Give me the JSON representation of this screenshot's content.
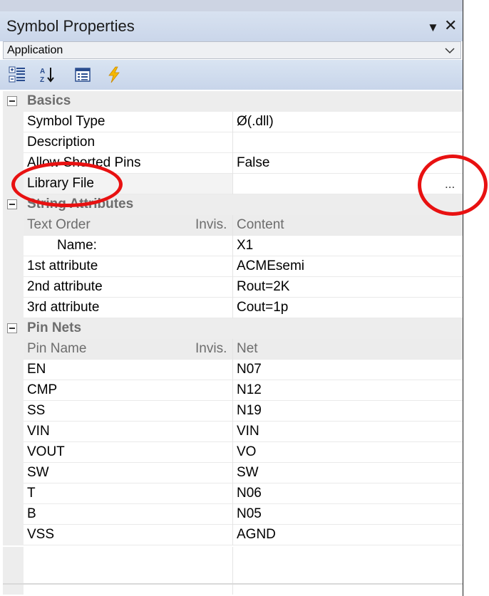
{
  "window": {
    "title": "Symbol Properties",
    "pin_glyph": "▼",
    "close_glyph": "✕"
  },
  "selector": {
    "value": "Application"
  },
  "toolbar": {
    "icons": [
      "categorized-icon",
      "alphabetical-sort-icon",
      "property-pages-icon",
      "events-icon"
    ]
  },
  "grid": {
    "basics": {
      "label": "Basics",
      "rows": [
        {
          "name": "Symbol Type",
          "value": "Ø(.dll)"
        },
        {
          "name": "Description",
          "value": ""
        },
        {
          "name": "Allow Shorted Pins",
          "value": "False"
        },
        {
          "name": "Library File",
          "value": "",
          "button": "..."
        }
      ]
    },
    "string_attributes": {
      "label": "String Attributes",
      "header": {
        "col1": "Text Order",
        "invis": "Invis.",
        "col2": "Content"
      },
      "rows": [
        {
          "name": "Name:",
          "value": "X1"
        },
        {
          "name": "1st attribute",
          "value": "ACMEsemi"
        },
        {
          "name": "2nd attribute",
          "value": "Rout=2K"
        },
        {
          "name": "3rd attribute",
          "value": "Cout=1p"
        }
      ]
    },
    "pin_nets": {
      "label": "Pin Nets",
      "header": {
        "col1": "Pin Name",
        "invis": "Invis.",
        "col2": "Net"
      },
      "rows": [
        {
          "name": "EN",
          "value": "N07"
        },
        {
          "name": "CMP",
          "value": "N12"
        },
        {
          "name": "SS",
          "value": "N19"
        },
        {
          "name": "VIN",
          "value": "VIN"
        },
        {
          "name": "VOUT",
          "value": "VO"
        },
        {
          "name": "SW",
          "value": "SW"
        },
        {
          "name": "T",
          "value": "N06"
        },
        {
          "name": "B",
          "value": "N05"
        },
        {
          "name": "VSS",
          "value": "AGND"
        }
      ]
    }
  },
  "colors": {
    "annotation": "#e81111",
    "category_bg": "#ededed",
    "titlebar": "#cad6ea"
  }
}
